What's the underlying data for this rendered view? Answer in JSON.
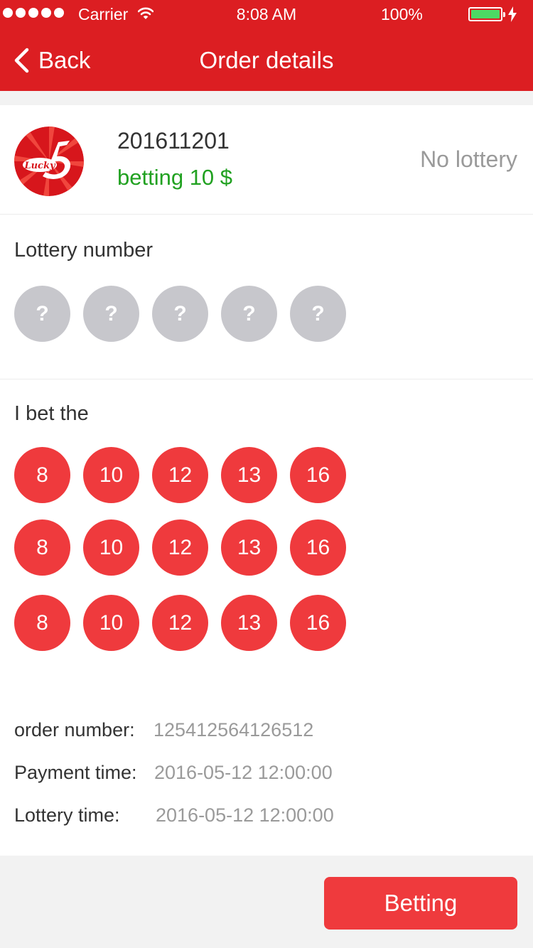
{
  "status_bar": {
    "carrier": "Carrier",
    "time": "8:08 AM",
    "battery": "100%",
    "battery_color": "#4cd964"
  },
  "nav": {
    "back_label": "Back",
    "title": "Order details",
    "background": "#dc1e22"
  },
  "order": {
    "logo_text": "Lucky",
    "issue": "201611201",
    "bet_amount": "betting 10 $",
    "status": "No lottery"
  },
  "lottery_number": {
    "label": "Lottery number",
    "balls": [
      "?",
      "?",
      "?",
      "?",
      "?"
    ]
  },
  "bets": {
    "label": "I bet the",
    "rows": [
      [
        "8",
        "10",
        "12",
        "13",
        "16"
      ],
      [
        "8",
        "10",
        "12",
        "13",
        "16"
      ],
      [
        "8",
        "10",
        "12",
        "13",
        "16"
      ]
    ]
  },
  "details": {
    "order_number_label": "order number:",
    "order_number": "125412564126512",
    "payment_time_label": "Payment time:",
    "payment_time": "2016-05-12 12:00:00",
    "lottery_time_label": "Lottery time:",
    "lottery_time": "2016-05-12 12:00:00"
  },
  "footer": {
    "betting_label": "Betting",
    "button_color": "#ef3a3d"
  }
}
